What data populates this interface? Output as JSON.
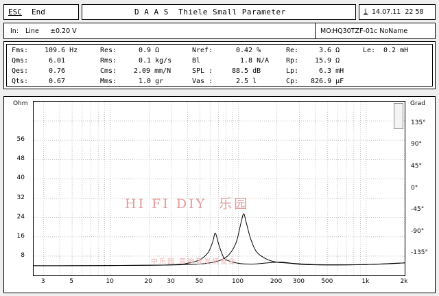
{
  "header": {
    "esc_key": "ESC",
    "esc_action": "End",
    "title": "D A A S  Thiele Small Parameter",
    "info_key": "i",
    "datetime": "14.07.11  22 58"
  },
  "input_bar": {
    "input_label": "In:",
    "input_value": "Line",
    "level": "±0.20 V",
    "mo_label": "MO:",
    "mo_value": "HQ30TZF-01c NoName"
  },
  "params": {
    "fms": {
      "label": "Fms:",
      "value": "109.6 Hz"
    },
    "qms": {
      "label": "Qms:",
      "value": "6.01"
    },
    "qes": {
      "label": "Qes:",
      "value": "0.76"
    },
    "qts": {
      "label": "Qts:",
      "value": "0.67"
    },
    "res": {
      "label": "Res:",
      "value": "0.9 Ω"
    },
    "rms": {
      "label": "Rms:",
      "value": "0.1 kg/s"
    },
    "cms": {
      "label": "Cms:",
      "value": "2.09 mm/N"
    },
    "mms": {
      "label": "Mms:",
      "value": "1.0 gr"
    },
    "nref": {
      "label": "Nref:",
      "value": "0.42 %"
    },
    "bl": {
      "label": "Bl",
      "value": "1.8 N/A"
    },
    "spl": {
      "label": "SPL :",
      "value": "88.5 dB"
    },
    "vas": {
      "label": "Vas :",
      "value": "2.5 l"
    },
    "re": {
      "label": "Re:",
      "value": "3.6 Ω"
    },
    "rp": {
      "label": "Rp:",
      "value": "15.9 Ω"
    },
    "lp": {
      "label": "Lp:",
      "value": "6.3 mH"
    },
    "cp": {
      "label": "Cp:",
      "value": "826.9 µF"
    },
    "le": {
      "label": "Le:",
      "value": "0.2 mH"
    }
  },
  "watermark": {
    "main": "HI FI DIY  乐园",
    "sub": "中乐园 音响音发烧友会"
  },
  "chart_data": {
    "type": "line",
    "xscale": "log",
    "xlim": [
      2.5,
      2000
    ],
    "x_ticks": [
      3,
      5,
      10,
      20,
      30,
      50,
      100,
      200,
      300,
      500,
      1000,
      2000
    ],
    "x_tick_labels": [
      "3",
      "5",
      "10",
      "20",
      "30",
      "50",
      "100",
      "200",
      "300",
      "500",
      "1k",
      "2k"
    ],
    "left_axis": {
      "unit": "Ohm",
      "ylim": [
        0,
        72
      ],
      "ticks": [
        "56",
        "48",
        "40",
        "32",
        "24",
        "16",
        "8"
      ],
      "tick_values": [
        56,
        48,
        40,
        32,
        24,
        16,
        8
      ]
    },
    "right_axis": {
      "unit": "Grad",
      "ylim": [
        -180,
        180
      ],
      "ticks": [
        "135°",
        "90°",
        "45°",
        "0°",
        "-45°",
        "-90°",
        "-135°"
      ],
      "tick_values": [
        135,
        90,
        45,
        0,
        -45,
        -90,
        -135
      ]
    },
    "series": [
      {
        "x": [
          2.5,
          5,
          10,
          20,
          40,
          60,
          80,
          95,
          105,
          110,
          115,
          125,
          140,
          170,
          200,
          230,
          260,
          300,
          400,
          600,
          1000,
          1500,
          2000
        ],
        "y": [
          4.0,
          4.0,
          4.1,
          4.2,
          4.5,
          5.2,
          7.5,
          13,
          22,
          25.5,
          22,
          15,
          9.5,
          6.5,
          5.5,
          5.2,
          5.0,
          4.8,
          4.5,
          4.4,
          4.5,
          4.8,
          5.2
        ]
      },
      {
        "x": [
          2.5,
          10,
          20,
          30,
          40,
          50,
          58,
          63,
          66,
          70,
          75,
          80,
          100,
          130,
          170,
          220,
          300,
          500,
          1000,
          2000
        ],
        "y": [
          4.0,
          4.1,
          4.2,
          4.4,
          5.0,
          6.5,
          9.5,
          14,
          17.5,
          13,
          8.5,
          6.5,
          5.0,
          4.7,
          5.2,
          5.5,
          4.6,
          4.3,
          4.5,
          5.2
        ]
      }
    ]
  }
}
